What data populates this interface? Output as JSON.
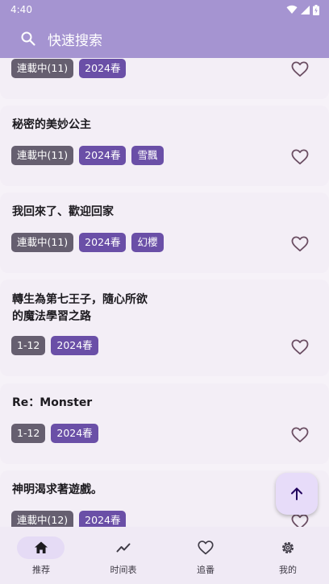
{
  "status_bar": {
    "time": "4:40"
  },
  "search": {
    "placeholder": "快速搜索"
  },
  "cards": [
    {
      "title": "",
      "tags": [
        {
          "label": "連載中(11)",
          "style": "gray"
        },
        {
          "label": "2024春",
          "style": "purple"
        }
      ]
    },
    {
      "title": "秘密的美妙公主",
      "tags": [
        {
          "label": "連載中(11)",
          "style": "gray"
        },
        {
          "label": "2024春",
          "style": "purple"
        },
        {
          "label": "雪飄",
          "style": "purple"
        }
      ]
    },
    {
      "title": "我回來了、歡迎回家",
      "tags": [
        {
          "label": "連載中(11)",
          "style": "gray"
        },
        {
          "label": "2024春",
          "style": "purple"
        },
        {
          "label": "幻櫻",
          "style": "purple"
        }
      ]
    },
    {
      "title_line1": "轉生為第七王子，隨心所欲",
      "title_line2": "的魔法學習之路",
      "tags": [
        {
          "label": "1-12",
          "style": "gray"
        },
        {
          "label": "2024春",
          "style": "purple"
        }
      ]
    },
    {
      "title": "Re：Monster",
      "tags": [
        {
          "label": "1-12",
          "style": "gray"
        },
        {
          "label": "2024春",
          "style": "purple"
        }
      ]
    },
    {
      "title": "神明渴求著遊戲。",
      "tags": [
        {
          "label": "連載中(12)",
          "style": "gray"
        },
        {
          "label": "2024春",
          "style": "purple"
        }
      ]
    }
  ],
  "nav": [
    {
      "label": "推荐",
      "icon": "home-icon",
      "active": true
    },
    {
      "label": "时间表",
      "icon": "trend-icon",
      "active": false
    },
    {
      "label": "追番",
      "icon": "heart-icon",
      "active": false
    },
    {
      "label": "我的",
      "icon": "gear-icon",
      "active": false
    }
  ],
  "colors": {
    "header": "#a594d1",
    "card": "#f3eef6",
    "tag_gray": "#665f70",
    "tag_purple": "#6a4fa7",
    "accent": "#6a4fa7"
  }
}
